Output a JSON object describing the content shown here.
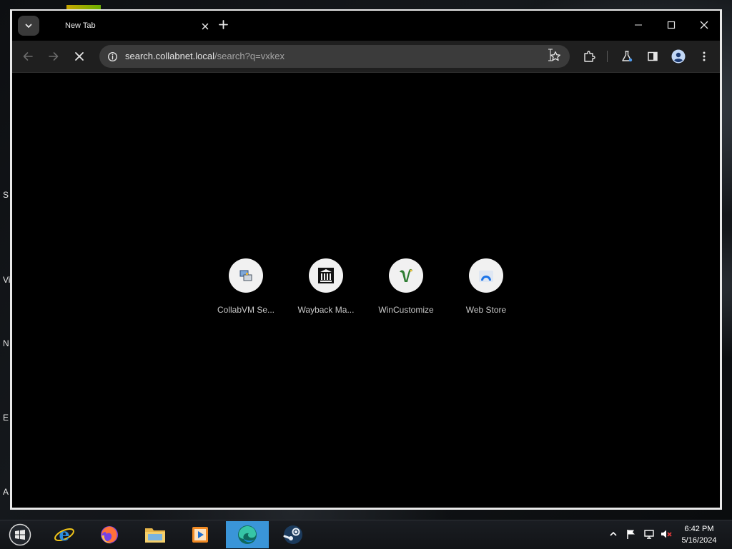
{
  "desktop": {
    "edge_letters": [
      "S",
      "Vi",
      "N",
      "E",
      "A"
    ]
  },
  "browser": {
    "tab": {
      "title": "New Tab"
    },
    "omnibox": {
      "url_host": "search.collabnet.local",
      "url_path": "/search?q=vxkex"
    },
    "shortcuts": [
      {
        "label": "CollabVM Se...",
        "icon": "collabvm-icon"
      },
      {
        "label": "Wayback Ma...",
        "icon": "archive-building-icon"
      },
      {
        "label": "WinCustomize",
        "icon": "wincustomize-icon"
      },
      {
        "label": "Web Store",
        "icon": "web-store-icon"
      }
    ]
  },
  "taskbar": {
    "apps": [
      "internet-explorer-icon",
      "firefox-icon",
      "file-explorer-icon",
      "media-player-icon",
      "edge-icon",
      "steam-icon"
    ],
    "active_app": "edge-icon",
    "clock": {
      "time": "6:42 PM",
      "date": "5/16/2024"
    }
  },
  "colors": {
    "window_bg": "#000000",
    "toolbar_bg": "#1f1f1f",
    "omnibox_bg": "#3b3b3b",
    "taskbar_active": "#3a95d8"
  }
}
